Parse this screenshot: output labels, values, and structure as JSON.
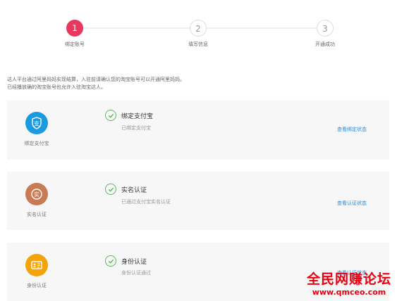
{
  "stepper": {
    "steps": [
      {
        "number": "1",
        "label": "绑定账号",
        "state": "active"
      },
      {
        "number": "2",
        "label": "填写信息",
        "state": "inactive"
      },
      {
        "number": "3",
        "label": "开通成功",
        "state": "inactive"
      }
    ]
  },
  "intro": {
    "line1": "达人平台通过阿里妈妈实现结算，入驻前请确认您的淘宝账号可以开通阿里妈妈。",
    "line2": "已经播放确的淘宝账号也允许入驻淘宝达人。"
  },
  "cards": [
    {
      "badge_label": "绑定支付宝",
      "badge_color": "#1a9be0",
      "badge_glyph": "支",
      "title": "绑定支付宝",
      "desc": "已绑定支付宝",
      "link": "查看绑定状态"
    },
    {
      "badge_label": "实名认证",
      "badge_color": "#c87a55",
      "badge_glyph": "实",
      "title": "实名认证",
      "desc": "已通过支付宝实名认证",
      "link": "查看认证状态"
    },
    {
      "badge_label": "身份认证",
      "badge_color": "#f4a30a",
      "badge_glyph": "",
      "title": "身份认证",
      "desc": "身份认证通过",
      "link": "查看认证状态"
    }
  ],
  "watermark": {
    "line1": "全民网赚论坛",
    "line2": "www.qmceo.com"
  }
}
